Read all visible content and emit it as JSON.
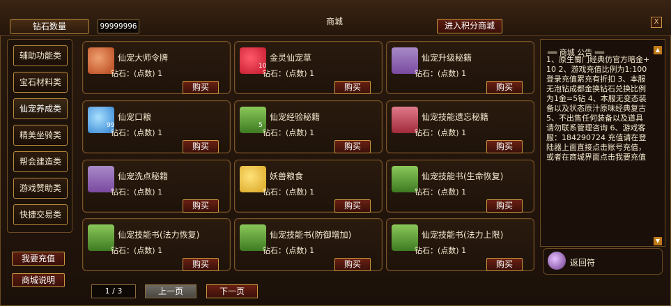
{
  "header": {
    "title": "商城",
    "diamond_label": "钻石数量",
    "diamond_value": "99999996",
    "points_mall_button": "进入积分商城",
    "close_label": "X"
  },
  "sidebar": {
    "categories": [
      {
        "label": "辅助功能类"
      },
      {
        "label": "宝石材料类"
      },
      {
        "label": "仙宠养成类"
      },
      {
        "label": "精美坐骑类"
      },
      {
        "label": "帮会建造类"
      },
      {
        "label": "游戏赞助类"
      },
      {
        "label": "快捷交易类"
      }
    ],
    "recharge_button": "我要充值",
    "mall_help_button": "商城说明"
  },
  "items": [
    {
      "name": "仙宠大师令牌",
      "price": "钻石：(点数) 1",
      "buy": "购买",
      "qty": "",
      "icon": "token-icon",
      "color": "#b5451b"
    },
    {
      "name": "金灵仙宠草",
      "price": "钻石：(点数) 1",
      "buy": "购买",
      "qty": "10",
      "icon": "herb-icon",
      "color": "#c0152a"
    },
    {
      "name": "仙宠升级秘籍",
      "price": "钻石：(点数) 1",
      "buy": "购买",
      "qty": "",
      "icon": "book-icon",
      "color": "#7a4aa0"
    },
    {
      "name": "仙宠口粮",
      "price": "钻石：(点数) 1",
      "buy": "购买",
      "qty": "99",
      "icon": "crystal-icon",
      "color": "#2f7fd0"
    },
    {
      "name": "仙宠经验秘籍",
      "price": "钻石：(点数) 1",
      "buy": "购买",
      "qty": "5",
      "icon": "book-icon",
      "color": "#3e7a22"
    },
    {
      "name": "仙宠技能遗忘秘籍",
      "price": "钻石：(点数) 1",
      "buy": "购买",
      "qty": "",
      "icon": "book-icon",
      "color": "#a02a3a"
    },
    {
      "name": "仙宠洗点秘籍",
      "price": "钻石：(点数) 1",
      "buy": "购买",
      "qty": "",
      "icon": "book-icon",
      "color": "#7a4aa0"
    },
    {
      "name": "妖兽粮食",
      "price": "钻石：(点数) 1",
      "buy": "购买",
      "qty": "",
      "icon": "food-icon",
      "color": "#d8a320"
    },
    {
      "name": "仙宠技能书(生命恢复)",
      "price": "钻石：(点数) 1",
      "buy": "购买",
      "qty": "",
      "icon": "book-icon",
      "color": "#3e7a22"
    },
    {
      "name": "仙宠技能书(法力恢复)",
      "price": "钻石：(点数) 1",
      "buy": "购买",
      "qty": "",
      "icon": "book-icon",
      "color": "#3e7a22"
    },
    {
      "name": "仙宠技能书(防御增加)",
      "price": "钻石：(点数) 1",
      "buy": "购买",
      "qty": "",
      "icon": "book-icon",
      "color": "#3e7a22"
    },
    {
      "name": "仙宠技能书(法力上限)",
      "price": "钻石：(点数) 1",
      "buy": "购买",
      "qty": "",
      "icon": "book-icon",
      "color": "#3e7a22"
    }
  ],
  "pagination": {
    "indicator": "1 / 3",
    "prev": "上一页",
    "next": "下一页"
  },
  "notice": {
    "title": "══ 商城 公告 ══",
    "text": "1、原生蜀门经典仿官方暗金+10 2、游戏充值比例为1:100登录充值累充有折扣 3、本服无泡钻成都金换钻石兑换比例为1金=5钻 4、本服无变态装备以及状态原汁原味经典复古 5、不出售任何装备以及道具 请勿联系管理咨询 6、游戏客服：184290724 充值请在登陆器上面直接点击账号充值，或者在商城界面点击我要充值"
  },
  "return_item": {
    "label": "返回符",
    "icon": "scroll-icon"
  }
}
